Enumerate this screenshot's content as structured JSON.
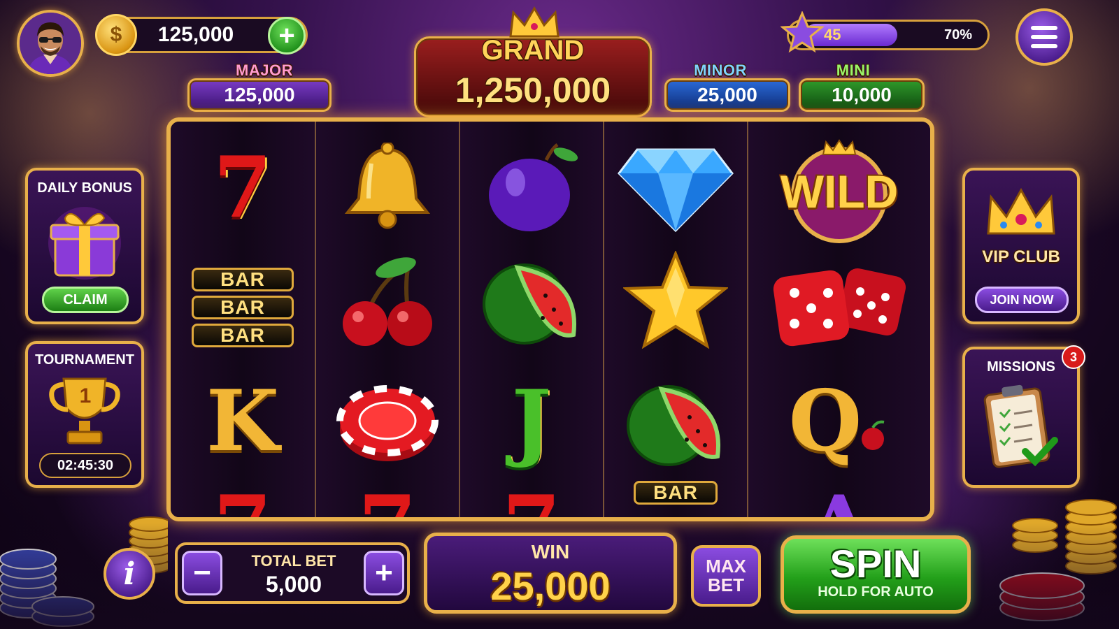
{
  "player": {
    "coins": "125,000",
    "level": "45",
    "xp_percent_label": "70%",
    "xp_progress": 0.7
  },
  "jackpots": {
    "grand": {
      "label": "GRAND",
      "value": "1,250,000"
    },
    "major": {
      "label": "MAJOR",
      "value": "125,000"
    },
    "minor": {
      "label": "MINOR",
      "value": "25,000"
    },
    "mini": {
      "label": "MINI",
      "value": "10,000"
    }
  },
  "reels": [
    [
      "seven",
      "bar-triple",
      "king",
      "seven-partial"
    ],
    [
      "bell",
      "cherries",
      "casino-chip",
      "seven-partial"
    ],
    [
      "plum",
      "watermelon",
      "jack",
      "seven-partial"
    ],
    [
      "diamond",
      "star",
      "watermelon",
      "bar-partial"
    ],
    [
      "wild",
      "dice",
      "queen",
      "ace-partial"
    ]
  ],
  "symbols": {
    "bar": "BAR",
    "wild": "WILD",
    "king": "K",
    "jack": "J",
    "queen": "Q",
    "seven": "7",
    "ace": "A"
  },
  "left_panels": {
    "daily_bonus": {
      "title": "DAILY BONUS",
      "button": "CLAIM"
    },
    "tournament": {
      "title": "TOURNAMENT",
      "rank": "1",
      "timer": "02:45:30"
    }
  },
  "right_panels": {
    "vip": {
      "title": "VIP CLUB",
      "button": "JOIN NOW"
    },
    "missions": {
      "title": "MISSIONS",
      "badge": "3"
    }
  },
  "bottom": {
    "total_bet_label": "TOTAL BET",
    "total_bet_value": "5,000",
    "minus": "−",
    "plus": "+",
    "win_label": "WIN",
    "win_value": "25,000",
    "max_bet_line1": "MAX",
    "max_bet_line2": "BET",
    "spin_label": "SPIN",
    "spin_sub": "HOLD FOR AUTO",
    "info": "i",
    "coin_symbol": "$",
    "add": "+"
  },
  "colors": {
    "gold": "#e8b04a",
    "spin_green": "#23a01a",
    "purple": "#4a1c8c",
    "grand_red": "#9a1e1e"
  }
}
